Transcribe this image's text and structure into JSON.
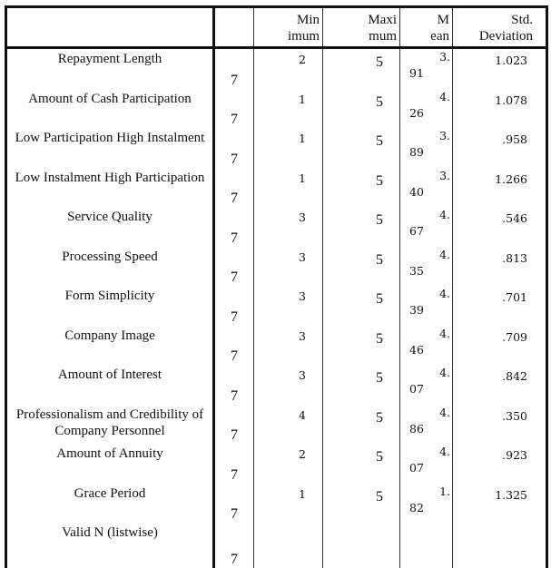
{
  "table": {
    "headers": {
      "label": "",
      "n": "",
      "minimum": "Min\nimum",
      "maximum": "Maxi\nmum",
      "mean": "M\nean",
      "std_deviation": "Std.\nDeviation"
    },
    "rows": [
      {
        "label": "Repayment Length",
        "n": "7",
        "minimum": "2",
        "maximum": "5",
        "mean_int": "3.",
        "mean_frac": "91",
        "std_dev": "1.023"
      },
      {
        "label": "Amount of Cash Participation",
        "n": "7",
        "minimum": "1",
        "maximum": "5",
        "mean_int": "4.",
        "mean_frac": "26",
        "std_dev": "1.078"
      },
      {
        "label": "Low Participation High Instalment",
        "n": "7",
        "minimum": "1",
        "maximum": "5",
        "mean_int": "3.",
        "mean_frac": "89",
        "std_dev": ".958"
      },
      {
        "label": "Low Instalment High Participation",
        "n": "7",
        "minimum": "1",
        "maximum": "5",
        "mean_int": "3.",
        "mean_frac": "40",
        "std_dev": "1.266"
      },
      {
        "label": "Service Quality",
        "n": "7",
        "minimum": "3",
        "maximum": "5",
        "mean_int": "4.",
        "mean_frac": "67",
        "std_dev": ".546"
      },
      {
        "label": "Processing Speed",
        "n": "7",
        "minimum": "3",
        "maximum": "5",
        "mean_int": "4.",
        "mean_frac": "35",
        "std_dev": ".813"
      },
      {
        "label": "Form Simplicity",
        "n": "7",
        "minimum": "3",
        "maximum": "5",
        "mean_int": "4.",
        "mean_frac": "39",
        "std_dev": ".701"
      },
      {
        "label": "Company Image",
        "n": "7",
        "minimum": "3",
        "maximum": "5",
        "mean_int": "4.",
        "mean_frac": "46",
        "std_dev": ".709"
      },
      {
        "label": "Amount of Interest",
        "n": "7",
        "minimum": "3",
        "maximum": "5",
        "mean_int": "4.",
        "mean_frac": "07",
        "std_dev": ".842"
      },
      {
        "label": "Professionalism and Credibility of Company Personnel",
        "n": "7",
        "minimum": "4",
        "maximum": "5",
        "mean_int": "4.",
        "mean_frac": "86",
        "std_dev": ".350"
      },
      {
        "label": "Amount of Annuity",
        "n": "7",
        "minimum": "2",
        "maximum": "5",
        "mean_int": "4.",
        "mean_frac": "07",
        "std_dev": ".923"
      },
      {
        "label": "Grace Period",
        "n": "7",
        "minimum": "1",
        "maximum": "5",
        "mean_int": "1.",
        "mean_frac": "82",
        "std_dev": "1.325"
      },
      {
        "label": "Valid N (listwise)",
        "n": "7",
        "minimum": "",
        "maximum": "",
        "mean_int": "",
        "mean_frac": "",
        "std_dev": ""
      }
    ]
  }
}
